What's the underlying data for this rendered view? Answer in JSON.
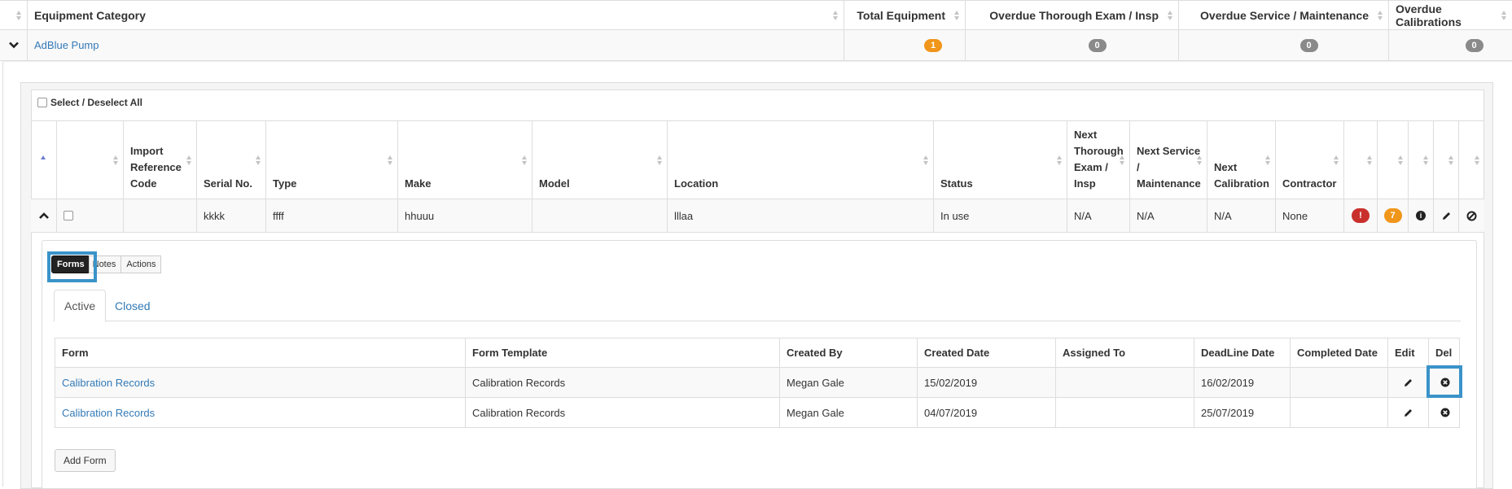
{
  "outer_table": {
    "headers": {
      "category": "Equipment Category",
      "total": "Total Equipment",
      "overdue_exam": "Overdue Thorough Exam / Insp",
      "overdue_service": "Overdue Service / Maintenance",
      "overdue_calibrations": "Overdue Calibrations"
    },
    "row": {
      "category": "AdBlue Pump",
      "total": "1",
      "overdue_exam": "0",
      "overdue_service": "0",
      "overdue_calibrations": "0"
    }
  },
  "equipment_table": {
    "select_all_label": "Select / Deselect All",
    "headers": {
      "import_ref": "Import Reference Code",
      "serial": "Serial No.",
      "type": "Type",
      "make": "Make",
      "model": "Model",
      "location": "Location",
      "status": "Status",
      "next_exam": "Next Thorough Exam / Insp",
      "next_service": "Next Service / Maintenance",
      "next_calibration": "Next Calibration",
      "contractor": "Contractor"
    },
    "row": {
      "import_ref": "",
      "serial": "kkkk",
      "type": "ffff",
      "make": "hhuuu",
      "model": "",
      "location": "lllaa",
      "status": "In use",
      "next_exam": "N/A",
      "next_service": "N/A",
      "next_calibration": "N/A",
      "contractor": "None",
      "alert_badge": "!",
      "count_badge": "7"
    }
  },
  "detail": {
    "buttons": {
      "forms": "Forms",
      "notes": "Notes",
      "actions": "Actions"
    },
    "tabs": {
      "active": "Active",
      "closed": "Closed"
    },
    "forms_table": {
      "headers": {
        "form": "Form",
        "template": "Form Template",
        "created_by": "Created By",
        "created_date": "Created Date",
        "assigned_to": "Assigned To",
        "deadline": "DeadLine Date",
        "completed": "Completed Date",
        "edit": "Edit",
        "del": "Del"
      },
      "rows": [
        {
          "form": "Calibration Records",
          "template": "Calibration Records",
          "created_by": "Megan Gale",
          "created_date": "15/02/2019",
          "assigned_to": "",
          "deadline": "16/02/2019",
          "completed": ""
        },
        {
          "form": "Calibration Records",
          "template": "Calibration Records",
          "created_by": "Megan Gale",
          "created_date": "04/07/2019",
          "assigned_to": "",
          "deadline": "25/07/2019",
          "completed": ""
        }
      ]
    },
    "add_form_label": "Add Form"
  },
  "colors": {
    "link": "#337ab7",
    "highlight": "#3a93c9",
    "badge_orange": "#f0961a",
    "badge_grey": "#8a8a8a",
    "badge_red": "#c9302c"
  }
}
